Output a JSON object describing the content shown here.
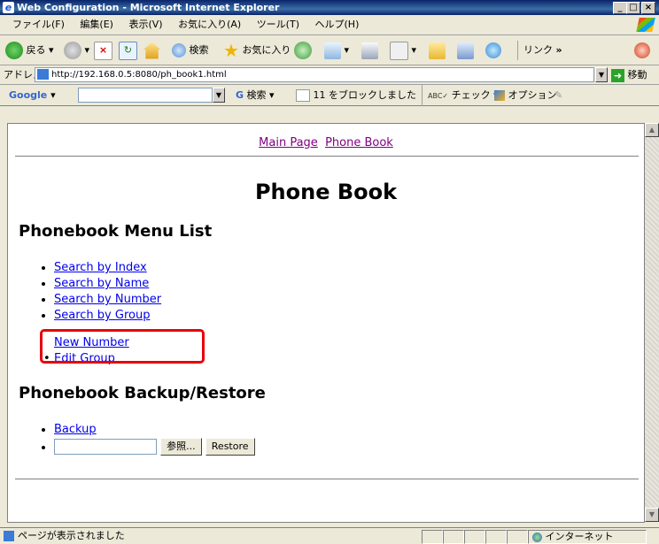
{
  "window": {
    "title": "Web Configuration - Microsoft Internet Explorer",
    "min": "_",
    "max": "□",
    "close": "×"
  },
  "menu": [
    "ファイル(F)",
    "編集(E)",
    "表示(V)",
    "お気に入り(A)",
    "ツール(T)",
    "ヘルプ(H)"
  ],
  "toolbar": {
    "back": "戻る",
    "search": "検索",
    "favorites": "お気に入り",
    "links": "リンク",
    "chevron": "»"
  },
  "address": {
    "label": "アドレス(D)",
    "url": "http://192.168.0.5:8080/ph_book1.html",
    "go": "移動"
  },
  "google": {
    "logo": "Google",
    "search": "検索",
    "blocked": "11 をブロックしました",
    "check": "チェック",
    "options": "オプション"
  },
  "page": {
    "nav": {
      "main": "Main Page",
      "phone": "Phone Book"
    },
    "title": "Phone Book",
    "menu_heading": "Phonebook Menu List",
    "search_items": [
      "Search by Index",
      "Search by Name",
      "Search by Number",
      "Search by Group"
    ],
    "new_number": "New Number",
    "edit_group": "Edit Group",
    "backup_heading": "Phonebook Backup/Restore",
    "backup": "Backup",
    "browse": "参照...",
    "restore": "Restore"
  },
  "status": {
    "text": "ページが表示されました",
    "zone": "インターネット"
  },
  "colors": {
    "highlight": "#e8000b",
    "title_bar": "#0a246a",
    "link": "#0000ee",
    "visited": "#800080"
  }
}
